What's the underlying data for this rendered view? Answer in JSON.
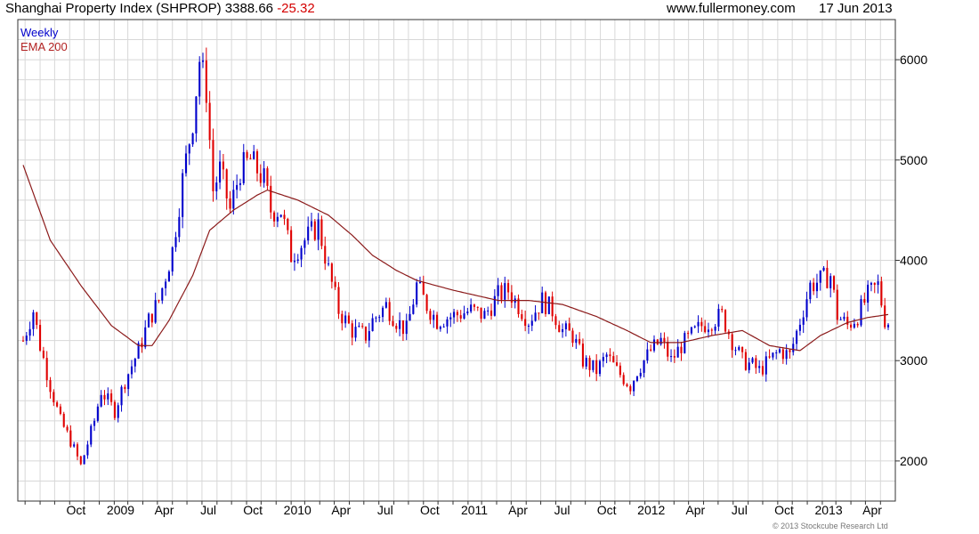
{
  "header": {
    "title": "Shanghai Property Index (SHPROP) 3388.66",
    "change": "-25.32",
    "site": "www.fullermoney.com",
    "date": "17 Jun 2013"
  },
  "legend": {
    "frequency": "Weekly",
    "ema_label": "EMA 200"
  },
  "copyright": "© 2013 Stockcube Research Ltd",
  "colors": {
    "up": "#0000cc",
    "down": "#e00000",
    "ema": "#8b1a1a",
    "grid": "#d8d8d8"
  },
  "chart_data": {
    "type": "candlestick",
    "title": "Shanghai Property Index (SHPROP) 3388.66 -25.32",
    "frequency": "Weekly",
    "y_ticks": [
      2000,
      3000,
      4000,
      5000,
      6000
    ],
    "ylim": [
      1600,
      6400
    ],
    "x_tick_labels": [
      "Oct",
      "2009",
      "Apr",
      "Jul",
      "Oct",
      "2010",
      "Apr",
      "Jul",
      "Oct",
      "2011",
      "Apr",
      "Jul",
      "Oct",
      "2012",
      "Apr",
      "Jul",
      "Oct",
      "2013",
      "Apr"
    ],
    "x_range": [
      "2008-07-28",
      "2013-06-17"
    ],
    "grid": true,
    "ema_name": "EMA 200",
    "series": [
      {
        "name": "Weekly",
        "close_anchors": [
          [
            "2008-07-28",
            3200
          ],
          [
            "2008-08-18",
            3500
          ],
          [
            "2008-09-01",
            3150
          ],
          [
            "2008-09-22",
            2750
          ],
          [
            "2008-10-13",
            2400
          ],
          [
            "2008-11-03",
            2200
          ],
          [
            "2008-11-24",
            1950
          ],
          [
            "2008-12-22",
            2400
          ],
          [
            "2009-01-05",
            2700
          ],
          [
            "2009-02-02",
            2500
          ],
          [
            "2009-02-23",
            2800
          ],
          [
            "2009-03-23",
            3100
          ],
          [
            "2009-04-13",
            3400
          ],
          [
            "2009-05-04",
            3600
          ],
          [
            "2009-06-01",
            4100
          ],
          [
            "2009-06-22",
            4800
          ],
          [
            "2009-07-13",
            5400
          ],
          [
            "2009-07-27",
            6000
          ],
          [
            "2009-08-10",
            5700
          ],
          [
            "2009-08-24",
            4700
          ],
          [
            "2009-09-07",
            4900
          ],
          [
            "2009-09-28",
            4500
          ],
          [
            "2009-10-19",
            4900
          ],
          [
            "2009-11-09",
            5000
          ],
          [
            "2009-12-07",
            4800
          ],
          [
            "2009-12-21",
            4500
          ],
          [
            "2010-01-11",
            4500
          ],
          [
            "2010-02-01",
            4050
          ],
          [
            "2010-03-01",
            4200
          ],
          [
            "2010-03-29",
            4350
          ],
          [
            "2010-04-19",
            3900
          ],
          [
            "2010-05-10",
            3500
          ],
          [
            "2010-06-07",
            3300
          ],
          [
            "2010-07-05",
            3250
          ],
          [
            "2010-07-19",
            3400
          ],
          [
            "2010-08-16",
            3550
          ],
          [
            "2010-09-06",
            3400
          ],
          [
            "2010-09-27",
            3300
          ],
          [
            "2010-10-18",
            3750
          ],
          [
            "2010-11-08",
            3550
          ],
          [
            "2010-11-29",
            3400
          ],
          [
            "2011-01-03",
            3450
          ],
          [
            "2011-02-07",
            3500
          ],
          [
            "2011-03-07",
            3450
          ],
          [
            "2011-04-04",
            3650
          ],
          [
            "2011-04-25",
            3700
          ],
          [
            "2011-05-16",
            3550
          ],
          [
            "2011-06-06",
            3400
          ],
          [
            "2011-07-04",
            3600
          ],
          [
            "2011-07-25",
            3500
          ],
          [
            "2011-08-15",
            3300
          ],
          [
            "2011-09-05",
            3250
          ],
          [
            "2011-09-26",
            3000
          ],
          [
            "2011-10-24",
            2900
          ],
          [
            "2011-11-14",
            3050
          ],
          [
            "2011-12-05",
            2900
          ],
          [
            "2012-01-02",
            2750
          ],
          [
            "2012-01-16",
            2900
          ],
          [
            "2012-02-13",
            3100
          ],
          [
            "2012-03-05",
            3200
          ],
          [
            "2012-03-26",
            3000
          ],
          [
            "2012-04-16",
            3150
          ],
          [
            "2012-05-07",
            3250
          ],
          [
            "2012-05-28",
            3350
          ],
          [
            "2012-06-18",
            3400
          ],
          [
            "2012-07-09",
            3450
          ],
          [
            "2012-07-30",
            3200
          ],
          [
            "2012-08-20",
            3000
          ],
          [
            "2012-09-10",
            2950
          ],
          [
            "2012-09-24",
            2900
          ],
          [
            "2012-10-15",
            3000
          ],
          [
            "2012-11-05",
            3100
          ],
          [
            "2012-11-26",
            3050
          ],
          [
            "2012-12-17",
            3400
          ],
          [
            "2013-01-07",
            3750
          ],
          [
            "2013-01-28",
            3800
          ],
          [
            "2013-02-18",
            3850
          ],
          [
            "2013-03-04",
            3450
          ],
          [
            "2013-03-25",
            3350
          ],
          [
            "2013-04-15",
            3450
          ],
          [
            "2013-05-06",
            3650
          ],
          [
            "2013-05-27",
            3750
          ],
          [
            "2013-06-10",
            3414
          ],
          [
            "2013-06-17",
            3388.66
          ]
        ]
      },
      {
        "name": "EMA 200",
        "anchors": [
          [
            "2008-07-28",
            4950
          ],
          [
            "2008-09-22",
            4200
          ],
          [
            "2008-11-24",
            3750
          ],
          [
            "2009-01-26",
            3350
          ],
          [
            "2009-03-23",
            3150
          ],
          [
            "2009-04-20",
            3150
          ],
          [
            "2009-05-25",
            3400
          ],
          [
            "2009-07-13",
            3850
          ],
          [
            "2009-08-17",
            4300
          ],
          [
            "2009-10-05",
            4500
          ],
          [
            "2009-11-23",
            4650
          ],
          [
            "2009-12-14",
            4700
          ],
          [
            "2010-02-15",
            4600
          ],
          [
            "2010-04-19",
            4450
          ],
          [
            "2010-06-07",
            4250
          ],
          [
            "2010-07-19",
            4050
          ],
          [
            "2010-09-06",
            3900
          ],
          [
            "2010-10-18",
            3800
          ],
          [
            "2011-01-03",
            3700
          ],
          [
            "2011-04-04",
            3600
          ],
          [
            "2011-06-06",
            3600
          ],
          [
            "2011-08-15",
            3560
          ],
          [
            "2011-10-24",
            3440
          ],
          [
            "2011-12-26",
            3300
          ],
          [
            "2012-02-13",
            3180
          ],
          [
            "2012-04-16",
            3180
          ],
          [
            "2012-06-18",
            3250
          ],
          [
            "2012-08-20",
            3300
          ],
          [
            "2012-10-15",
            3150
          ],
          [
            "2012-12-17",
            3100
          ],
          [
            "2013-01-28",
            3250
          ],
          [
            "2013-03-25",
            3380
          ],
          [
            "2013-05-06",
            3430
          ],
          [
            "2013-06-17",
            3460
          ]
        ]
      }
    ]
  }
}
